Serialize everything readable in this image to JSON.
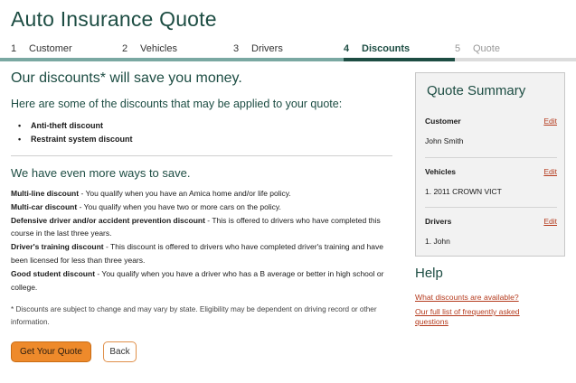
{
  "page": {
    "title": "Auto Insurance Quote"
  },
  "steps": [
    {
      "num": "1",
      "label": "Customer"
    },
    {
      "num": "2",
      "label": "Vehicles"
    },
    {
      "num": "3",
      "label": "Drivers"
    },
    {
      "num": "4",
      "label": "Discounts"
    },
    {
      "num": "5",
      "label": "Quote"
    }
  ],
  "main": {
    "headline": "Our discounts* will save you money.",
    "intro": "Here are some of the discounts that may be applied to your quote:",
    "discounts": [
      "Anti-theft discount",
      "Restraint system discount"
    ],
    "more_heading": "We have even more ways to save.",
    "more": [
      {
        "name": "Multi-line discount",
        "text": " - You qualify when you have an Amica home and/or life policy."
      },
      {
        "name": "Multi-car discount",
        "text": " - You qualify when you have two or more cars on the policy."
      },
      {
        "name": "Defensive driver and/or accident prevention discount",
        "text": " - This is offered to drivers who have completed this course in the last three years."
      },
      {
        "name": "Driver's training discount",
        "text": " - This discount is offered to drivers who have completed driver's training and have been licensed for less than three years."
      },
      {
        "name": "Good student discount",
        "text": " - You qualify when you have a driver who has a B average or better in high school or college."
      }
    ],
    "footnote": "* Discounts are subject to change and may vary by state. Eligibility may be dependent on driving record or other information."
  },
  "buttons": {
    "primary": "Get Your Quote",
    "back": "Back"
  },
  "summary": {
    "title": "Quote Summary",
    "edit_label": "Edit",
    "customer": {
      "label": "Customer",
      "value": "John Smith"
    },
    "vehicles": {
      "label": "Vehicles",
      "value": "1. 2011 CROWN VICT"
    },
    "drivers": {
      "label": "Drivers",
      "value": "1. John"
    }
  },
  "help": {
    "title": "Help",
    "links": [
      "What discounts are available?",
      "Our full list of frequently asked questions"
    ]
  }
}
